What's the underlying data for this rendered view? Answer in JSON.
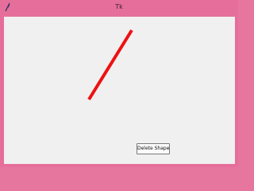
{
  "window": {
    "title": "Tk",
    "icon": "feather-icon"
  },
  "canvas": {
    "shape": {
      "type": "line",
      "color": "#ee1111"
    }
  },
  "buttons": {
    "delete_label": "Delete Shape"
  },
  "colors": {
    "frame": "#e56f9a",
    "canvas_bg": "#f0f0f0",
    "line": "#ee1111"
  }
}
